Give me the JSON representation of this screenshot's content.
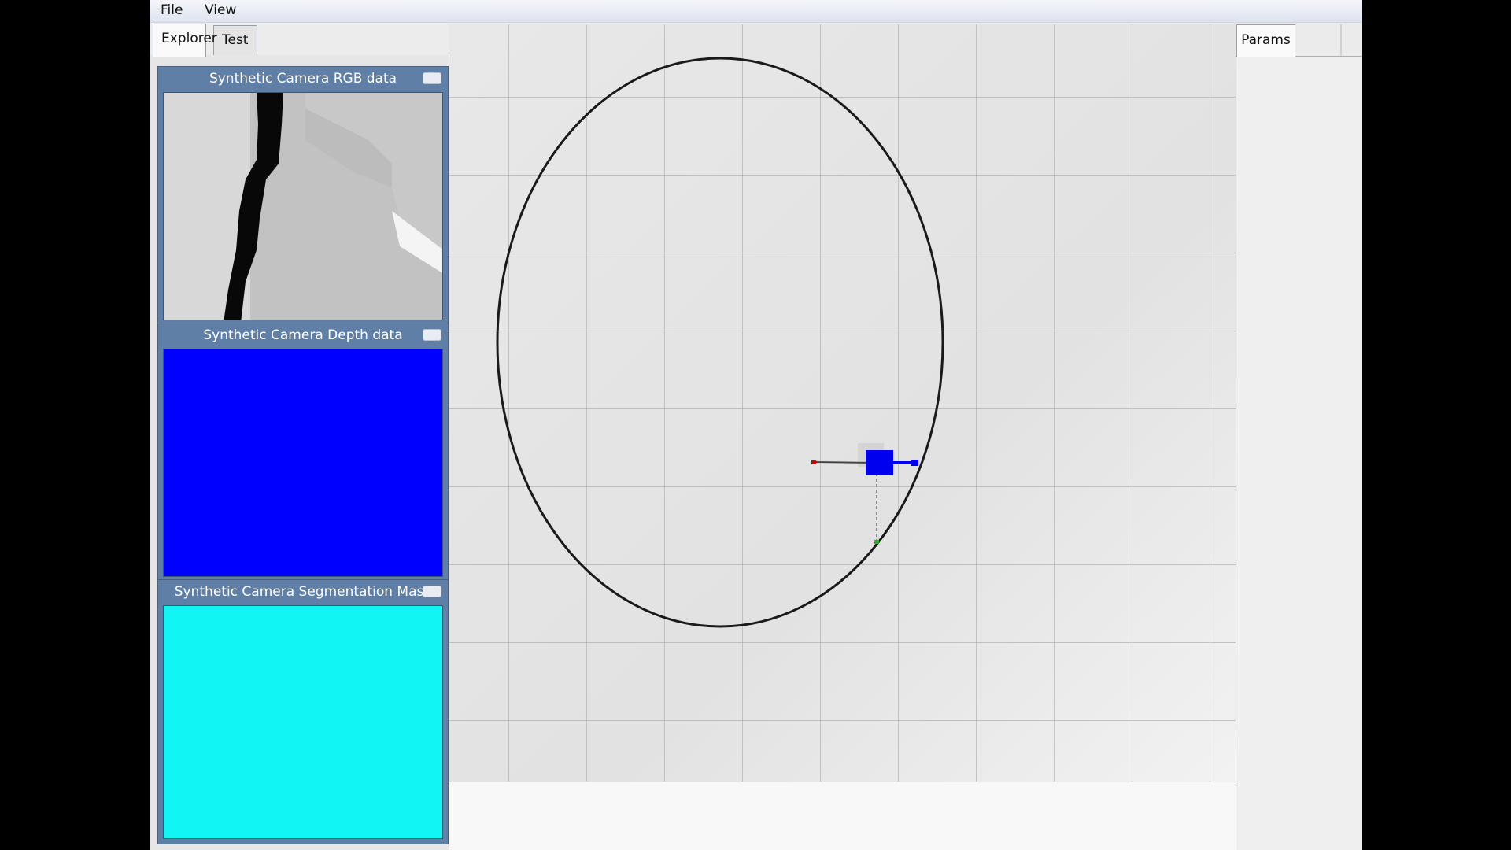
{
  "menu": {
    "file": "File",
    "view": "View"
  },
  "left_tabs": [
    {
      "label": "Explorer"
    },
    {
      "label": "Test"
    }
  ],
  "right_tabs": [
    {
      "label": "Params"
    }
  ],
  "docks": {
    "rgb": {
      "title": "Synthetic Camera RGB data"
    },
    "depth": {
      "title": "Synthetic Camera Depth data",
      "fill_color": "#0000ff"
    },
    "segmentation": {
      "title": "Synthetic Camera Segmentation Mask",
      "fill_color": "#12f5f5"
    }
  },
  "scene": {
    "track": "ellipse",
    "robot_color": "#0000ee",
    "x_axis_color": "#d00000",
    "y_axis_color": "#33aa33",
    "z_axis_color": "#0000ee"
  }
}
